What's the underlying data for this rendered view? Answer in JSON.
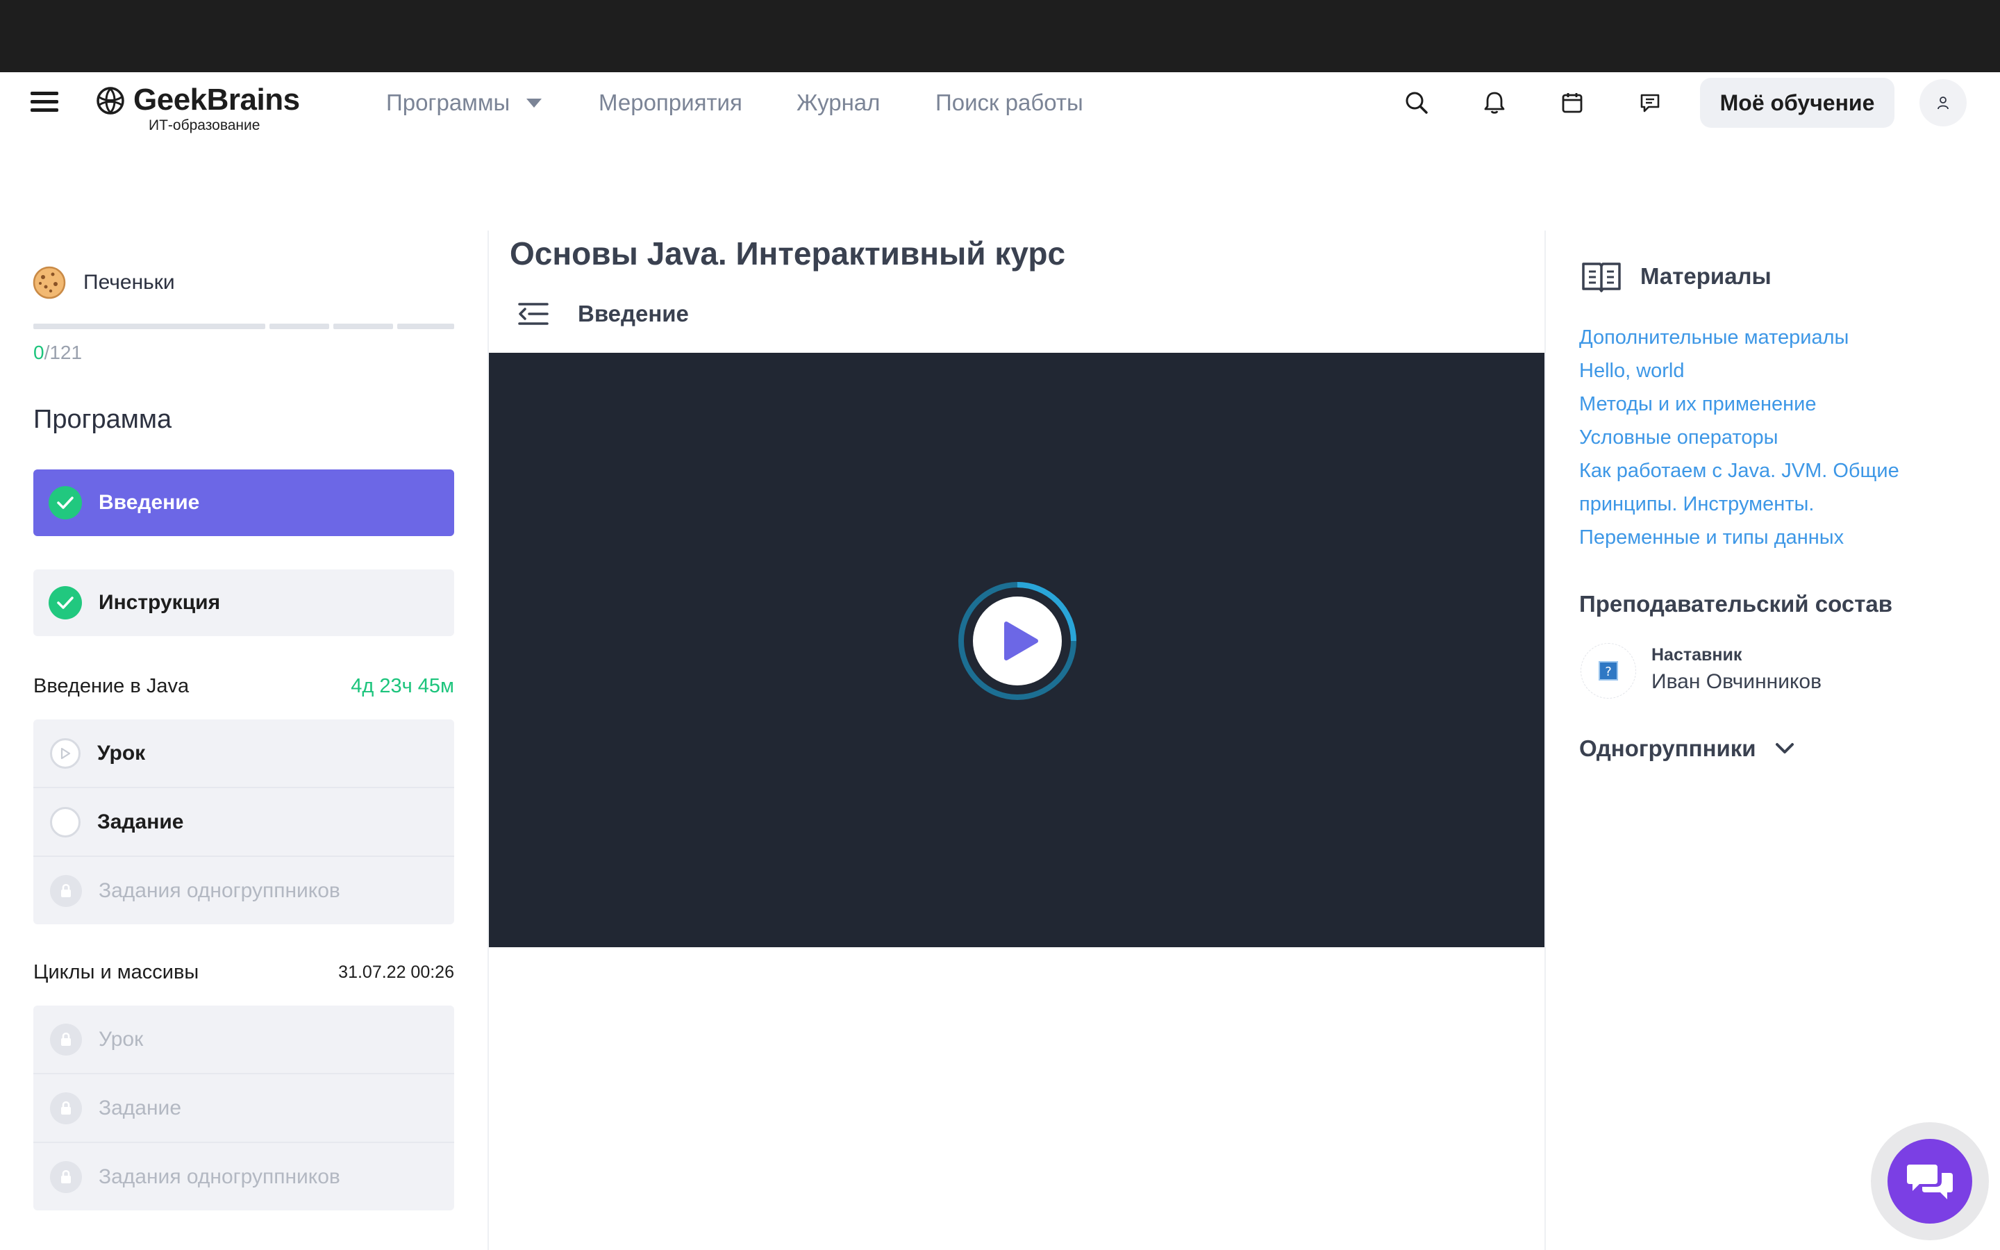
{
  "header": {
    "logo_name": "GeekBrains",
    "logo_sub": "ИТ-образование",
    "nav": [
      "Программы",
      "Мероприятия",
      "Журнал",
      "Поиск работы"
    ],
    "my_learning": "Моё обучение"
  },
  "sidebar": {
    "cookies_label": "Печеньки",
    "score_value": "0",
    "score_total": "/121",
    "program_title": "Программа",
    "intro_item": "Введение",
    "instruction_item": "Инструкция",
    "sections": [
      {
        "title": "Введение в Java",
        "time": "4д 23ч 45м",
        "items": [
          "Урок",
          "Задание",
          "Задания одногруппников"
        ]
      },
      {
        "title": "Циклы и массивы",
        "time": "31.07.22 00:26",
        "items": [
          "Урок",
          "Задание",
          "Задания одногруппников"
        ]
      }
    ]
  },
  "main": {
    "course_title": "Основы Java. Интерактивный курс",
    "lesson_title": "Введение"
  },
  "materials": {
    "title": "Материалы",
    "links": [
      "Дополнительные материалы",
      "Hello, world",
      "Методы и их применение",
      "Условные операторы",
      "Как работаем с Java. JVM. Общие принципы. Инструменты.",
      "Переменные и типы данных"
    ]
  },
  "teachers": {
    "title": "Преподавательский состав",
    "role": "Наставник",
    "name": "Иван Овчинников"
  },
  "groupmates": "Одногруппники",
  "colors": {
    "accent": "#6c67e6",
    "success": "#21c87f",
    "link": "#3d97e6",
    "chat": "#7b3fe4",
    "video_bg": "#212733"
  }
}
